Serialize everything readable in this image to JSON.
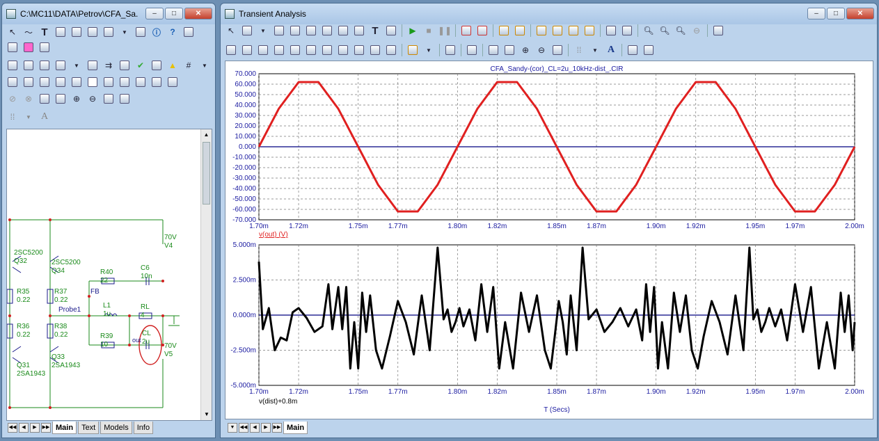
{
  "left_window": {
    "title": "C:\\MC11\\DATA\\Petrov\\CFA_Sa...",
    "min": "–",
    "max": "□",
    "close": "✕",
    "tabs": [
      "Main",
      "Text",
      "Models",
      "Info"
    ],
    "schematic": {
      "parts": [
        {
          "ref": "2SC5200",
          "sub": "Q32"
        },
        {
          "ref": "2SC5200",
          "sub": "Q34"
        },
        {
          "ref": "R35",
          "sub": "0.22"
        },
        {
          "ref": "R37",
          "sub": "0.22"
        },
        {
          "ref": "R36",
          "sub": "0.22"
        },
        {
          "ref": "R38",
          "sub": "0.22"
        },
        {
          "ref": "Q31",
          "sub": "2SA1943"
        },
        {
          "ref": "Q33",
          "sub": "2SA1943"
        },
        {
          "ref": "R40",
          "sub": "22"
        },
        {
          "ref": "C6",
          "sub": "10n"
        },
        {
          "ref": "L1",
          "sub": "1u"
        },
        {
          "ref": "RL",
          "sub": "4"
        },
        {
          "ref": "R39",
          "sub": "10"
        },
        {
          "ref": "CL",
          "sub": "2u"
        },
        {
          "ref": "70V",
          "sub": "V4"
        },
        {
          "ref": "70V",
          "sub": "V5"
        }
      ],
      "labels": {
        "fb": "FB",
        "probe": "Probe1",
        "out": "out"
      }
    }
  },
  "right_window": {
    "title": "Transient Analysis",
    "min": "–",
    "max": "□",
    "close": "✕",
    "tabs": [
      "Main"
    ]
  },
  "chart_data": [
    {
      "type": "line",
      "title": "CFA_Sandy-(cor)_CL=2u_10kHz-dist_.CIR",
      "x": [
        1.7,
        1.72,
        1.75,
        1.77,
        1.8,
        1.82,
        1.85,
        1.87,
        1.9,
        1.92,
        1.95,
        1.97,
        2.0
      ],
      "xlim": [
        1.7,
        2.0
      ],
      "xtick_labels": [
        "1.70m",
        "1.72m",
        "1.75m",
        "1.77m",
        "1.80m",
        "1.82m",
        "1.85m",
        "1.87m",
        "1.90m",
        "1.92m",
        "1.95m",
        "1.97m",
        "2.00m"
      ],
      "ylim": [
        -70,
        70
      ],
      "ytick_labels": [
        "70.000",
        "60.000",
        "50.000",
        "40.000",
        "30.000",
        "20.000",
        "10.000",
        "0.000",
        "-10.000",
        "-20.000",
        "-30.000",
        "-40.000",
        "-50.000",
        "-60.000",
        "-70.000"
      ],
      "series": [
        {
          "name": "v(out) (V)",
          "color": "#e02020",
          "x": [
            1.7,
            1.71,
            1.72,
            1.73,
            1.74,
            1.75,
            1.76,
            1.77,
            1.78,
            1.79,
            1.8,
            1.81,
            1.82,
            1.83,
            1.84,
            1.85,
            1.86,
            1.87,
            1.88,
            1.89,
            1.9,
            1.91,
            1.92,
            1.93,
            1.94,
            1.95,
            1.96,
            1.97,
            1.98,
            1.99,
            2.0
          ],
          "values": [
            0,
            36.4,
            62,
            62,
            36.4,
            0,
            -36.4,
            -62,
            -62,
            -36.4,
            0,
            36.4,
            62,
            62,
            36.4,
            0,
            -36.4,
            -62,
            -62,
            -36.4,
            0,
            36.4,
            62,
            62,
            36.4,
            0,
            -36.4,
            -62,
            -62,
            -36.4,
            0
          ]
        }
      ],
      "grid": true
    },
    {
      "type": "line",
      "x": [
        1.7,
        1.72,
        1.75,
        1.77,
        1.8,
        1.82,
        1.85,
        1.87,
        1.9,
        1.92,
        1.95,
        1.97,
        2.0
      ],
      "xlim": [
        1.7,
        2.0
      ],
      "xtick_labels": [
        "1.70m",
        "1.72m",
        "1.75m",
        "1.77m",
        "1.80m",
        "1.82m",
        "1.85m",
        "1.87m",
        "1.90m",
        "1.92m",
        "1.95m",
        "1.97m",
        "2.00m"
      ],
      "ylim": [
        -5.0,
        5.0
      ],
      "ytick_labels": [
        "5.000m",
        "2.500m",
        "0.000m",
        "-2.500m",
        "-5.000m"
      ],
      "xlabel": "T (Secs)",
      "series": [
        {
          "name": "v(dist)+0.8m",
          "color": "#000000",
          "x": [
            1.7,
            1.702,
            1.705,
            1.708,
            1.711,
            1.714,
            1.717,
            1.72,
            1.724,
            1.728,
            1.732,
            1.735,
            1.737,
            1.74,
            1.742,
            1.744,
            1.746,
            1.748,
            1.75,
            1.752,
            1.754,
            1.756,
            1.759,
            1.762,
            1.766,
            1.77,
            1.774,
            1.778,
            1.782,
            1.786,
            1.79,
            1.793,
            1.795,
            1.797,
            1.799,
            1.801,
            1.803,
            1.806,
            1.809,
            1.812,
            1.815,
            1.818,
            1.821,
            1.824,
            1.828,
            1.832,
            1.836,
            1.84,
            1.844,
            1.847,
            1.849,
            1.851,
            1.853,
            1.855,
            1.857,
            1.86,
            1.863,
            1.866,
            1.87,
            1.874,
            1.878,
            1.882,
            1.886,
            1.89,
            1.893,
            1.895,
            1.897,
            1.899,
            1.901,
            1.903,
            1.906,
            1.909,
            1.912,
            1.915,
            1.918,
            1.921,
            1.924,
            1.928,
            1.932,
            1.936,
            1.94,
            1.944,
            1.947,
            1.949,
            1.951,
            1.953,
            1.955,
            1.957,
            1.96,
            1.963,
            1.966,
            1.97,
            1.974,
            1.978,
            1.982,
            1.986,
            1.99,
            1.993,
            1.995,
            1.997,
            1.999,
            2.0
          ],
          "values": [
            3.8,
            -1.0,
            0.5,
            -2.5,
            -1.6,
            -1.8,
            0.2,
            0.5,
            -0.2,
            -1.2,
            -0.8,
            2.2,
            -1.0,
            2.0,
            -1.0,
            2.0,
            -3.8,
            -0.5,
            -3.8,
            1.6,
            -1.2,
            1.4,
            -2.5,
            -3.8,
            -1.5,
            1.0,
            -0.5,
            -2.8,
            1.4,
            -2.5,
            4.8,
            -0.3,
            0.4,
            -1.2,
            -0.5,
            0.5,
            -0.8,
            0.4,
            -1.8,
            2.2,
            -1.2,
            2.0,
            -3.8,
            -0.5,
            -3.8,
            1.6,
            -1.2,
            1.4,
            -2.5,
            -3.8,
            -1.5,
            1.0,
            -0.5,
            -2.8,
            1.4,
            -2.5,
            4.8,
            -0.3,
            0.4,
            -1.2,
            -0.5,
            0.5,
            -0.8,
            0.4,
            -1.8,
            2.2,
            -1.2,
            2.0,
            -3.8,
            -0.5,
            -3.8,
            1.6,
            -1.2,
            1.4,
            -2.5,
            -3.8,
            -1.5,
            1.0,
            -0.5,
            -2.8,
            1.4,
            -2.5,
            4.8,
            -0.3,
            0.4,
            -1.2,
            -0.5,
            0.5,
            -0.8,
            0.4,
            -1.8,
            2.2,
            -1.2,
            2.0,
            -3.8,
            -0.5,
            -3.8,
            1.6,
            -1.2,
            1.4,
            -2.5,
            -0.5
          ]
        }
      ],
      "grid": true
    }
  ]
}
